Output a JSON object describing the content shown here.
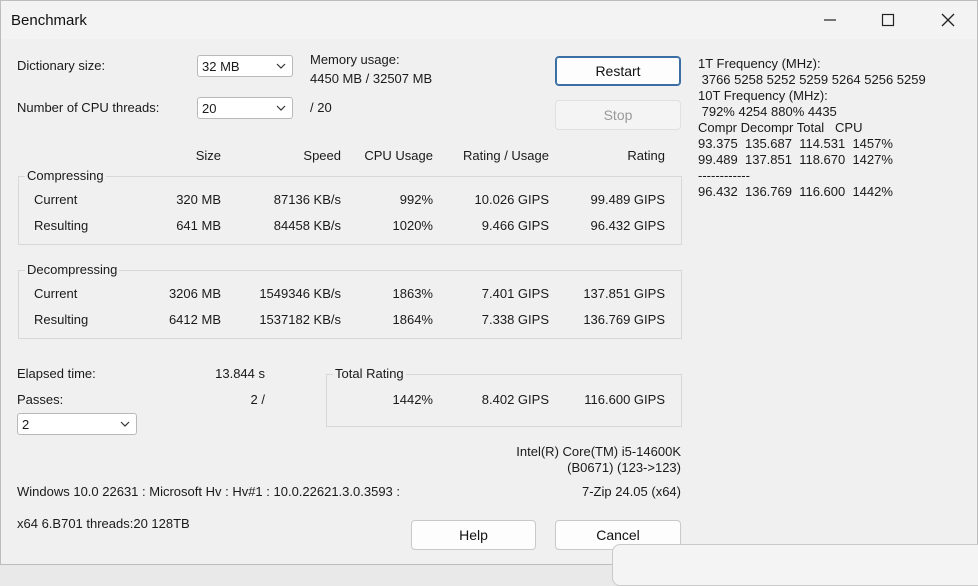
{
  "window": {
    "title": "Benchmark"
  },
  "settings": {
    "dict_label": "Dictionary size:",
    "dict_value": "32 MB",
    "threads_label": "Number of CPU threads:",
    "threads_value": "20",
    "threads_total": "/ 20",
    "mem_label": "Memory usage:",
    "mem_value": "4450 MB / 32507 MB"
  },
  "buttons": {
    "restart": "Restart",
    "stop": "Stop",
    "help": "Help",
    "cancel": "Cancel"
  },
  "table": {
    "headers": [
      "Size",
      "Speed",
      "CPU Usage",
      "Rating / Usage",
      "Rating"
    ],
    "compressing": {
      "label": "Compressing",
      "rows": [
        {
          "name": "Current",
          "size": "320 MB",
          "speed": "87136 KB/s",
          "cpu": "992%",
          "rpu": "10.026 GIPS",
          "rating": "99.489 GIPS"
        },
        {
          "name": "Resulting",
          "size": "641 MB",
          "speed": "84458 KB/s",
          "cpu": "1020%",
          "rpu": "9.466 GIPS",
          "rating": "96.432 GIPS"
        }
      ]
    },
    "decompressing": {
      "label": "Decompressing",
      "rows": [
        {
          "name": "Current",
          "size": "3206 MB",
          "speed": "1549346 KB/s",
          "cpu": "1863%",
          "rpu": "7.401 GIPS",
          "rating": "137.851 GIPS"
        },
        {
          "name": "Resulting",
          "size": "6412 MB",
          "speed": "1537182 KB/s",
          "cpu": "1864%",
          "rpu": "7.338 GIPS",
          "rating": "136.769 GIPS"
        }
      ]
    }
  },
  "elapsed": {
    "label": "Elapsed time:",
    "value": "13.844 s"
  },
  "passes": {
    "label": "Passes:",
    "value": "2 /",
    "combo_value": "2"
  },
  "total": {
    "label": "Total Rating",
    "cpu": "1442%",
    "rpu": "8.402 GIPS",
    "rating": "116.600 GIPS"
  },
  "cpu_info": {
    "line1": "Intel(R) Core(TM) i5-14600K",
    "line2": "(B0671) (123->123)"
  },
  "system": {
    "os": "Windows 10.0 22631 : Microsoft Hv : Hv#1 : 10.0.22621.3.0.3593 :",
    "version": "7-Zip 24.05 (x64)",
    "arch": "x64 6.B701 threads:20 128TB"
  },
  "log": [
    "1T Frequency (MHz):",
    " 3766 5258 5252 5259 5264 5256 5259",
    "10T Frequency (MHz):",
    " 792% 4254 880% 4435",
    "Compr Decompr Total   CPU",
    "93.375  135.687  114.531  1457%",
    "99.489  137.851  118.670  1427%",
    "------------",
    "96.432  136.769  116.600  1442%"
  ]
}
